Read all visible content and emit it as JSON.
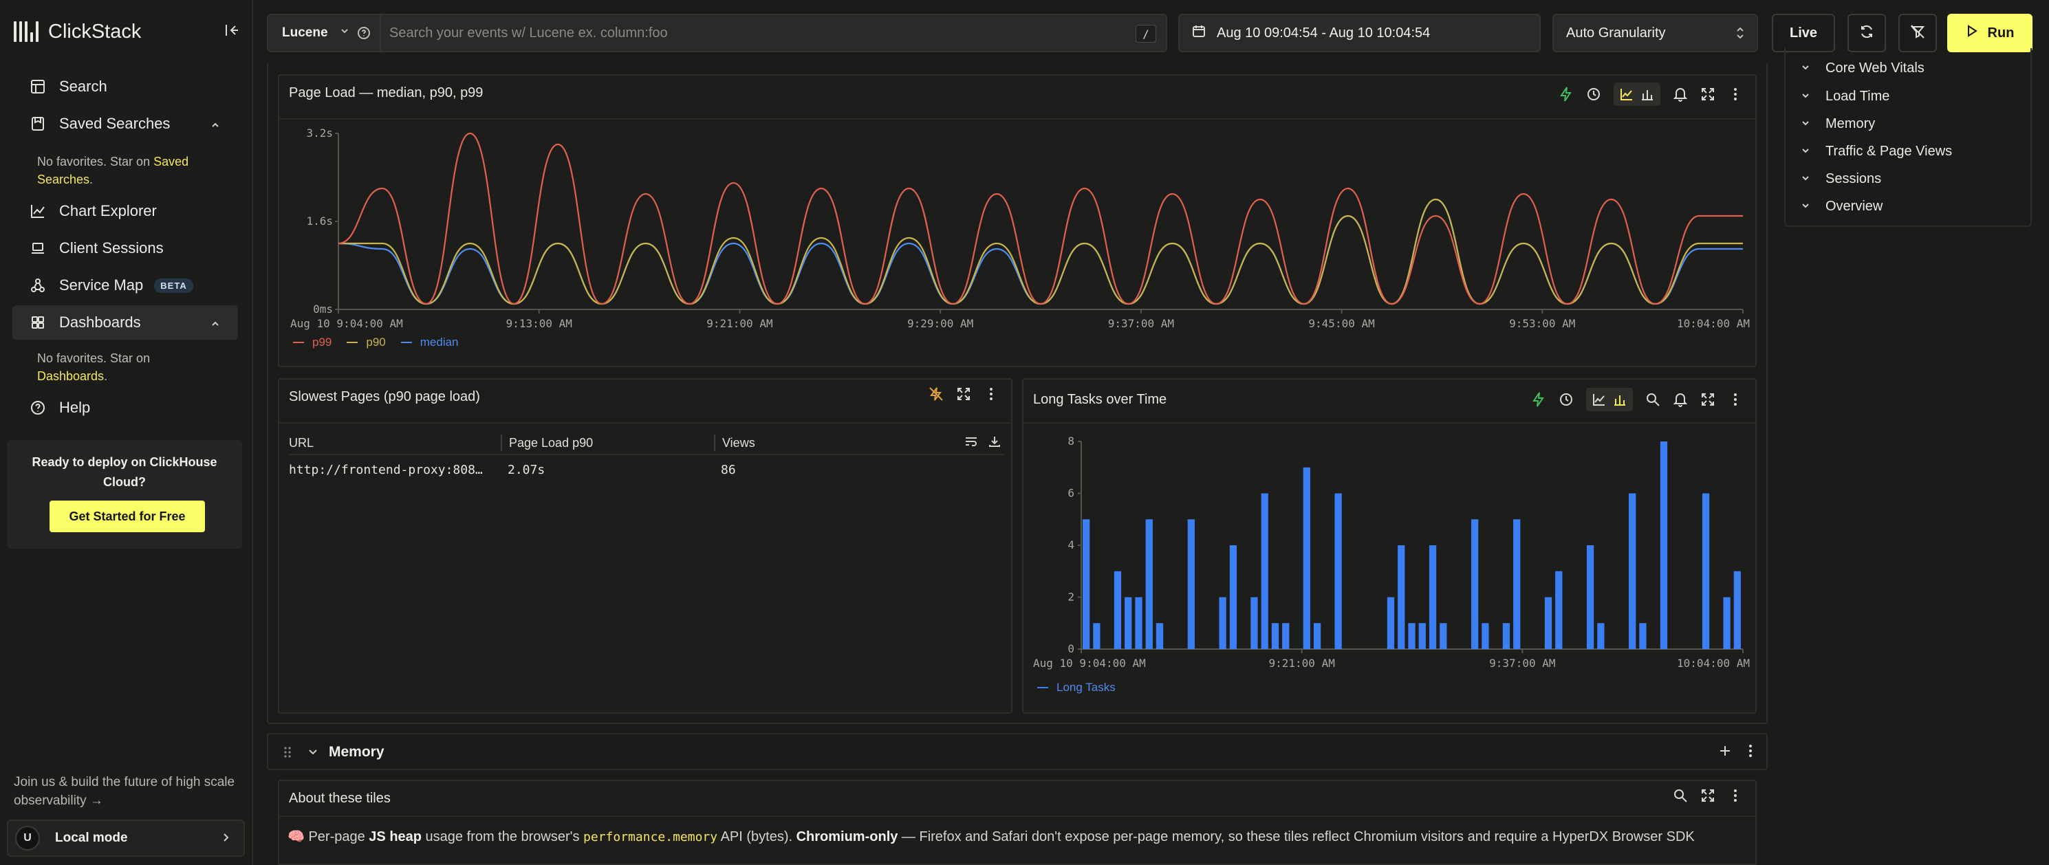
{
  "app": {
    "name": "ClickStack"
  },
  "sidebar": {
    "nav": [
      {
        "label": "Search"
      },
      {
        "label": "Saved Searches"
      },
      {
        "label": "Chart Explorer"
      },
      {
        "label": "Client Sessions"
      },
      {
        "label": "Service Map",
        "badge": "BETA"
      },
      {
        "label": "Dashboards"
      },
      {
        "label": "Help"
      }
    ],
    "saved_fav_note": "No favorites. Star on",
    "saved_fav_link": "Saved Searches",
    "dash_fav_note": "No favorites. Star on",
    "dash_fav_link": "Dashboards",
    "period": ".",
    "cloud_text": "Ready to deploy on ClickHouse Cloud?",
    "cloud_button": "Get Started for Free",
    "join_text": "Join us & build the future of high scale observability →",
    "user_initial": "U",
    "user_mode": "Local mode"
  },
  "toolbar": {
    "query_language": "Lucene",
    "search_placeholder": "Search your events w/ Lucene ex. column:foo",
    "slash_key": "/",
    "time_range": "Aug 10 09:04:54 - Aug 10 10:04:54",
    "granularity": "Auto Granularity",
    "live_label": "Live",
    "run_label": "Run"
  },
  "outline": {
    "items": [
      "Core Web Vitals",
      "Load Time",
      "Memory",
      "Traffic & Page Views",
      "Sessions",
      "Overview"
    ]
  },
  "tiles": {
    "page_load": {
      "title": "Page Load — median, p90, p99"
    },
    "slowest_pages": {
      "title": "Slowest Pages (p90 page load)",
      "columns": [
        "URL",
        "Page Load p90",
        "Views"
      ],
      "rows": [
        {
          "url": "http://frontend-proxy:808…",
          "p90": "2.07s",
          "views": "86"
        }
      ]
    },
    "long_tasks": {
      "title": "Long Tasks over Time"
    }
  },
  "memory_section": {
    "title": "Memory",
    "about_title": "About these tiles",
    "desc_prefix": "🧠 Per-page ",
    "desc_bold1": "JS heap",
    "desc_mid1": " usage from the browser's ",
    "desc_code": "performance.memory",
    "desc_mid2": " API (bytes). ",
    "desc_bold2": "Chromium-only",
    "desc_rest": " — Firefox and Safari don't expose per-page memory, so these tiles reflect Chromium visitors and require a HyperDX Browser SDK"
  },
  "colors": {
    "accent": "#faff69",
    "p99": "#e0604e",
    "p90": "#c9b64a",
    "median": "#4f8bf0",
    "bar": "#3b7ff2",
    "green": "#3fbf5f"
  },
  "chart_data": [
    {
      "type": "line",
      "title": "Page Load — median, p90, p99",
      "x_ticks": [
        "Aug 10 9:04:00 AM",
        "9:13:00 AM",
        "9:21:00 AM",
        "9:29:00 AM",
        "9:37:00 AM",
        "9:45:00 AM",
        "9:53:00 AM",
        "10:04:00 AM"
      ],
      "y_ticks": [
        "0ms",
        "1.6s",
        "3.2s"
      ],
      "ylim": [
        0,
        3.2
      ],
      "legend_position": "bottom-left",
      "series": [
        {
          "name": "p99",
          "color": "#e0604e",
          "values": [
            1.2,
            2.2,
            0.1,
            3.2,
            0.1,
            3.0,
            0.1,
            2.1,
            0.1,
            2.3,
            0.1,
            2.2,
            0.1,
            2.2,
            0.1,
            2.1,
            0.1,
            2.2,
            0.1,
            2.1,
            0.1,
            2.0,
            0.1,
            2.2,
            0.1,
            1.7,
            0.1,
            2.1,
            0.1,
            2.0,
            0.1,
            1.7,
            1.7
          ]
        },
        {
          "name": "p90",
          "color": "#c9b64a",
          "values": [
            1.2,
            1.2,
            0.1,
            1.2,
            0.1,
            1.2,
            0.1,
            1.2,
            0.1,
            1.3,
            0.1,
            1.3,
            0.1,
            1.3,
            0.1,
            1.2,
            0.1,
            1.2,
            0.1,
            1.2,
            0.1,
            1.2,
            0.1,
            1.7,
            0.1,
            2.0,
            0.1,
            1.2,
            0.1,
            1.2,
            0.1,
            1.2,
            1.2
          ]
        },
        {
          "name": "median",
          "color": "#4f8bf0",
          "values": [
            1.2,
            1.1,
            0.1,
            1.1,
            0.1,
            1.2,
            0.1,
            1.2,
            0.1,
            1.2,
            0.1,
            1.2,
            0.1,
            1.2,
            0.1,
            1.1,
            0.1,
            1.2,
            0.1,
            1.2,
            0.1,
            1.2,
            0.1,
            1.7,
            0.1,
            2.0,
            0.1,
            1.2,
            0.1,
            1.2,
            0.1,
            1.1,
            1.1
          ]
        }
      ]
    },
    {
      "type": "bar",
      "title": "Long Tasks over Time",
      "x_ticks": [
        "Aug 10 9:04:00 AM",
        "9:21:00 AM",
        "9:37:00 AM",
        "10:04:00 AM"
      ],
      "y_ticks": [
        "0",
        "2",
        "4",
        "6",
        "8"
      ],
      "ylim": [
        0,
        8
      ],
      "legend_position": "bottom-left",
      "series": [
        {
          "name": "Long Tasks",
          "color": "#3b7ff2",
          "values": [
            5,
            1,
            0,
            3,
            2,
            2,
            5,
            1,
            0,
            0,
            5,
            0,
            0,
            2,
            4,
            0,
            2,
            6,
            1,
            1,
            0,
            7,
            1,
            0,
            6,
            0,
            0,
            0,
            0,
            2,
            4,
            1,
            1,
            4,
            1,
            0,
            0,
            5,
            1,
            0,
            1,
            5,
            0,
            0,
            2,
            3,
            0,
            0,
            4,
            1,
            0,
            0,
            6,
            1,
            0,
            8,
            0,
            0,
            0,
            6,
            0,
            2,
            3
          ]
        }
      ]
    }
  ]
}
